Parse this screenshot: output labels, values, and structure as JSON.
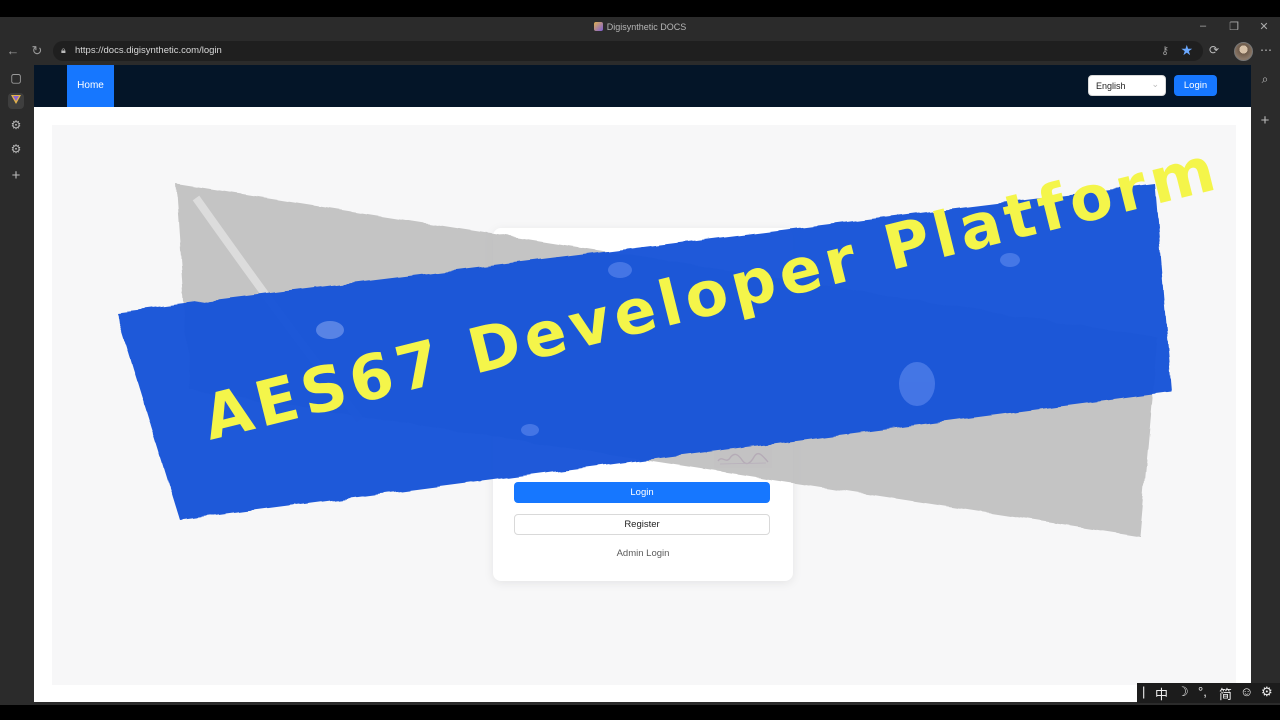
{
  "window": {
    "title": "Digisynthetic DOCS"
  },
  "address_bar": {
    "url": "https://docs.digisynthetic.com/login"
  },
  "nav": {
    "home_label": "Home",
    "language_value": "English",
    "login_label": "Login"
  },
  "login_card": {
    "login_button": "Login",
    "register_button": "Register",
    "admin_login_link": "Admin Login"
  },
  "banner": {
    "text": "AES67 Developer Platform"
  },
  "ime": {
    "items": [
      "|",
      "中",
      "☽",
      "°,",
      "简",
      "☺",
      "⚙"
    ]
  },
  "colors": {
    "primary": "#1677ff",
    "nav_bg": "#041528",
    "banner_text": "#f4f54a",
    "tape_blue": "#1552d8",
    "tape_gray": "#bdbdbd"
  }
}
